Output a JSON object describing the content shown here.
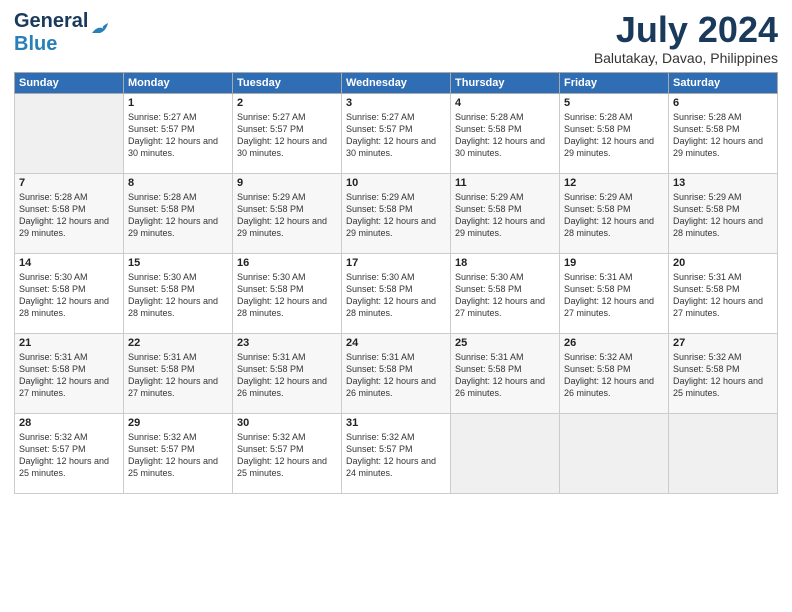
{
  "header": {
    "logo_line1": "General",
    "logo_line2": "Blue",
    "month": "July 2024",
    "location": "Balutakay, Davao, Philippines"
  },
  "weekdays": [
    "Sunday",
    "Monday",
    "Tuesday",
    "Wednesday",
    "Thursday",
    "Friday",
    "Saturday"
  ],
  "weeks": [
    [
      {
        "day": "",
        "sunrise": "",
        "sunset": "",
        "daylight": ""
      },
      {
        "day": "1",
        "sunrise": "5:27 AM",
        "sunset": "5:57 PM",
        "daylight": "12 hours and 30 minutes."
      },
      {
        "day": "2",
        "sunrise": "5:27 AM",
        "sunset": "5:57 PM",
        "daylight": "12 hours and 30 minutes."
      },
      {
        "day": "3",
        "sunrise": "5:27 AM",
        "sunset": "5:57 PM",
        "daylight": "12 hours and 30 minutes."
      },
      {
        "day": "4",
        "sunrise": "5:28 AM",
        "sunset": "5:58 PM",
        "daylight": "12 hours and 30 minutes."
      },
      {
        "day": "5",
        "sunrise": "5:28 AM",
        "sunset": "5:58 PM",
        "daylight": "12 hours and 29 minutes."
      },
      {
        "day": "6",
        "sunrise": "5:28 AM",
        "sunset": "5:58 PM",
        "daylight": "12 hours and 29 minutes."
      }
    ],
    [
      {
        "day": "7",
        "sunrise": "5:28 AM",
        "sunset": "5:58 PM",
        "daylight": "12 hours and 29 minutes."
      },
      {
        "day": "8",
        "sunrise": "5:28 AM",
        "sunset": "5:58 PM",
        "daylight": "12 hours and 29 minutes."
      },
      {
        "day": "9",
        "sunrise": "5:29 AM",
        "sunset": "5:58 PM",
        "daylight": "12 hours and 29 minutes."
      },
      {
        "day": "10",
        "sunrise": "5:29 AM",
        "sunset": "5:58 PM",
        "daylight": "12 hours and 29 minutes."
      },
      {
        "day": "11",
        "sunrise": "5:29 AM",
        "sunset": "5:58 PM",
        "daylight": "12 hours and 29 minutes."
      },
      {
        "day": "12",
        "sunrise": "5:29 AM",
        "sunset": "5:58 PM",
        "daylight": "12 hours and 28 minutes."
      },
      {
        "day": "13",
        "sunrise": "5:29 AM",
        "sunset": "5:58 PM",
        "daylight": "12 hours and 28 minutes."
      }
    ],
    [
      {
        "day": "14",
        "sunrise": "5:30 AM",
        "sunset": "5:58 PM",
        "daylight": "12 hours and 28 minutes."
      },
      {
        "day": "15",
        "sunrise": "5:30 AM",
        "sunset": "5:58 PM",
        "daylight": "12 hours and 28 minutes."
      },
      {
        "day": "16",
        "sunrise": "5:30 AM",
        "sunset": "5:58 PM",
        "daylight": "12 hours and 28 minutes."
      },
      {
        "day": "17",
        "sunrise": "5:30 AM",
        "sunset": "5:58 PM",
        "daylight": "12 hours and 28 minutes."
      },
      {
        "day": "18",
        "sunrise": "5:30 AM",
        "sunset": "5:58 PM",
        "daylight": "12 hours and 27 minutes."
      },
      {
        "day": "19",
        "sunrise": "5:31 AM",
        "sunset": "5:58 PM",
        "daylight": "12 hours and 27 minutes."
      },
      {
        "day": "20",
        "sunrise": "5:31 AM",
        "sunset": "5:58 PM",
        "daylight": "12 hours and 27 minutes."
      }
    ],
    [
      {
        "day": "21",
        "sunrise": "5:31 AM",
        "sunset": "5:58 PM",
        "daylight": "12 hours and 27 minutes."
      },
      {
        "day": "22",
        "sunrise": "5:31 AM",
        "sunset": "5:58 PM",
        "daylight": "12 hours and 27 minutes."
      },
      {
        "day": "23",
        "sunrise": "5:31 AM",
        "sunset": "5:58 PM",
        "daylight": "12 hours and 26 minutes."
      },
      {
        "day": "24",
        "sunrise": "5:31 AM",
        "sunset": "5:58 PM",
        "daylight": "12 hours and 26 minutes."
      },
      {
        "day": "25",
        "sunrise": "5:31 AM",
        "sunset": "5:58 PM",
        "daylight": "12 hours and 26 minutes."
      },
      {
        "day": "26",
        "sunrise": "5:32 AM",
        "sunset": "5:58 PM",
        "daylight": "12 hours and 26 minutes."
      },
      {
        "day": "27",
        "sunrise": "5:32 AM",
        "sunset": "5:58 PM",
        "daylight": "12 hours and 25 minutes."
      }
    ],
    [
      {
        "day": "28",
        "sunrise": "5:32 AM",
        "sunset": "5:57 PM",
        "daylight": "12 hours and 25 minutes."
      },
      {
        "day": "29",
        "sunrise": "5:32 AM",
        "sunset": "5:57 PM",
        "daylight": "12 hours and 25 minutes."
      },
      {
        "day": "30",
        "sunrise": "5:32 AM",
        "sunset": "5:57 PM",
        "daylight": "12 hours and 25 minutes."
      },
      {
        "day": "31",
        "sunrise": "5:32 AM",
        "sunset": "5:57 PM",
        "daylight": "12 hours and 24 minutes."
      },
      {
        "day": "",
        "sunrise": "",
        "sunset": "",
        "daylight": ""
      },
      {
        "day": "",
        "sunrise": "",
        "sunset": "",
        "daylight": ""
      },
      {
        "day": "",
        "sunrise": "",
        "sunset": "",
        "daylight": ""
      }
    ]
  ]
}
